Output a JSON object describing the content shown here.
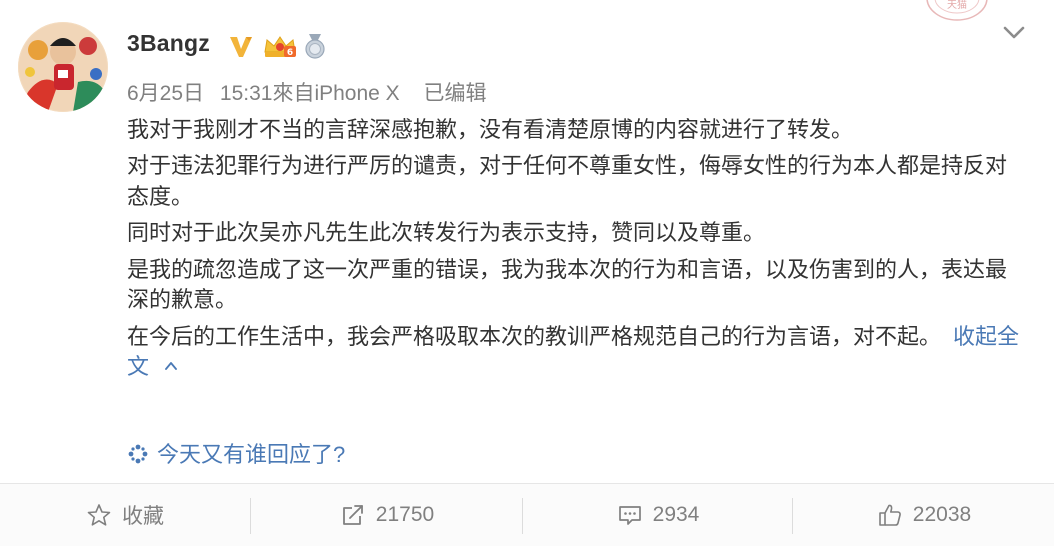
{
  "post": {
    "username": "3Bangz",
    "date": "6月25日",
    "time": "15:31",
    "source": "來自iPhone X",
    "edited": "已编辑",
    "paragraphs": [
      "我对于我刚才不当的言辞深感抱歉，没有看清楚原博的内容就进行了转发。",
      "对于违法犯罪行为进行严厉的谴责，对于任何不尊重女性，侮辱女性的行为本人都是持反对态度。",
      "同时对于此次吴亦凡先生此次转发行为表示支持，赞同以及尊重。",
      "是我的疏忽造成了这一次严重的错误，我为我本次的行为和言语，以及伤害到的人，表达最深的歉意。",
      "在今后的工作生活中，我会严格吸取本次的教训严格规范自己的行为言语，对不起。"
    ],
    "collapse_label": "收起全文",
    "topic_text": "今天又有谁回应了?",
    "stamp_text": "天猫"
  },
  "actions": {
    "favorite_label": "收藏",
    "repost_count": "21750",
    "comment_count": "2934",
    "like_count": "22038"
  },
  "colors": {
    "link": "#4a79b5",
    "badge_v": "#f2b43a",
    "muted": "#808080"
  },
  "icons": [
    "avatar",
    "verified-v-icon",
    "crown-badge-icon",
    "medal-badge-icon",
    "chevron-down-icon",
    "caret-up-icon",
    "topic-sparkle-icon",
    "star-icon",
    "repost-icon",
    "comment-icon",
    "like-icon"
  ]
}
